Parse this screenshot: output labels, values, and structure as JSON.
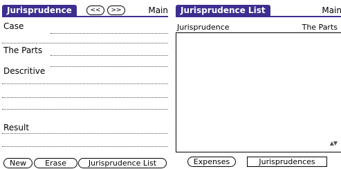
{
  "left_screen": {
    "title": "Jurisprudence",
    "prev_label": "<<",
    "next_label": ">>",
    "menu": "Main",
    "fields": [
      {
        "label": "Case"
      },
      {
        "label": "The Parts"
      },
      {
        "label": "Descritive"
      },
      {
        "label": "Result"
      }
    ],
    "buttons": {
      "new": "New",
      "erase": "Erase",
      "list": "Jurisprudence List"
    }
  },
  "right_screen": {
    "title": "Jurisprudence List",
    "menu": "Main",
    "columns": [
      "Jurisprudence",
      "The Parts"
    ],
    "rows": [],
    "buttons": {
      "expenses": "Expenses",
      "jurisprudences": "Jurisprudences"
    },
    "scroll_icon": "scroll-arrows-icon"
  },
  "colors": {
    "title_bg": "#3c2f8f",
    "title_text": "#ffffff"
  }
}
